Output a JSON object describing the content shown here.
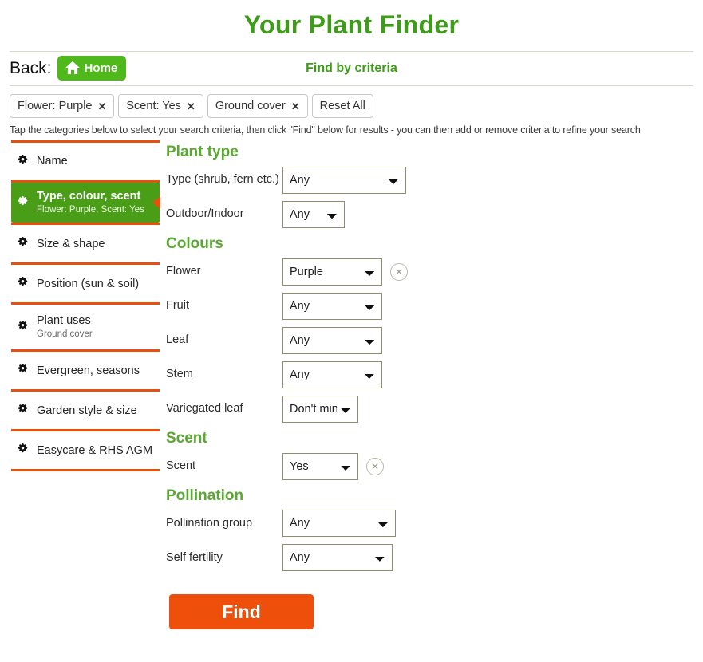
{
  "header": {
    "title": "Your Plant Finder",
    "back_label": "Back:",
    "home_label": "Home",
    "home_icon": "home-icon",
    "page_mode": "Find by criteria"
  },
  "criteria_chips": [
    {
      "label": "Flower: Purple",
      "remove_icon": "✕"
    },
    {
      "label": "Scent: Yes",
      "remove_icon": "✕"
    },
    {
      "label": "Ground cover",
      "remove_icon": "✕"
    }
  ],
  "reset_all_label": "Reset All",
  "hint": "Tap the categories below to select your search criteria, then click \"Find\" below for results - you can then add or remove criteria to refine your search",
  "sidebar": {
    "items": [
      {
        "label": "Name",
        "sub": "",
        "selected": false
      },
      {
        "label": "Type, colour, scent",
        "sub": "Flower: Purple, Scent: Yes",
        "selected": true
      },
      {
        "label": "Size & shape",
        "sub": "",
        "selected": false
      },
      {
        "label": "Position (sun & soil)",
        "sub": "",
        "selected": false
      },
      {
        "label": "Plant uses",
        "sub": "Ground cover",
        "selected": false
      },
      {
        "label": "Evergreen, seasons",
        "sub": "",
        "selected": false
      },
      {
        "label": "Garden style & size",
        "sub": "",
        "selected": false
      },
      {
        "label": "Easycare & RHS AGM",
        "sub": "",
        "selected": false
      }
    ]
  },
  "main": {
    "sections": [
      {
        "title": "Plant type",
        "fields": [
          {
            "label": "Type (shrub, fern etc.)",
            "value": "Any",
            "width": "w-155",
            "clear": false
          },
          {
            "label": "Outdoor/Indoor",
            "value": "Any",
            "width": "w-78",
            "clear": false
          }
        ]
      },
      {
        "title": "Colours",
        "fields": [
          {
            "label": "Flower",
            "value": "Purple",
            "width": "w-125",
            "clear": true
          },
          {
            "label": "Fruit",
            "value": "Any",
            "width": "w-125",
            "clear": false
          },
          {
            "label": "Leaf",
            "value": "Any",
            "width": "w-125",
            "clear": false
          },
          {
            "label": "Stem",
            "value": "Any",
            "width": "w-125",
            "clear": false
          },
          {
            "label": "Variegated leaf",
            "value": "Don't mind",
            "width": "w-95",
            "clear": false
          }
        ]
      },
      {
        "title": "Scent",
        "fields": [
          {
            "label": "Scent",
            "value": "Yes",
            "width": "w-95",
            "clear": true
          }
        ]
      },
      {
        "title": "Pollination",
        "fields": [
          {
            "label": "Pollination group",
            "value": "Any",
            "width": "w-142",
            "clear": false
          },
          {
            "label": "Self fertility",
            "value": "Any",
            "width": "w-138",
            "clear": false
          }
        ]
      }
    ],
    "find_label": "Find"
  },
  "select_options": [
    "Any",
    "Purple",
    "Yes",
    "Don't mind"
  ],
  "colors": {
    "brand_green": "#3f9c1a",
    "selected_green": "#4a9e17",
    "home_green": "#4fb81b",
    "section_green": "#5aa832",
    "accent_orange": "#e8500f",
    "find_orange": "#ee4f0b",
    "select_border": "#8e8e6e"
  }
}
